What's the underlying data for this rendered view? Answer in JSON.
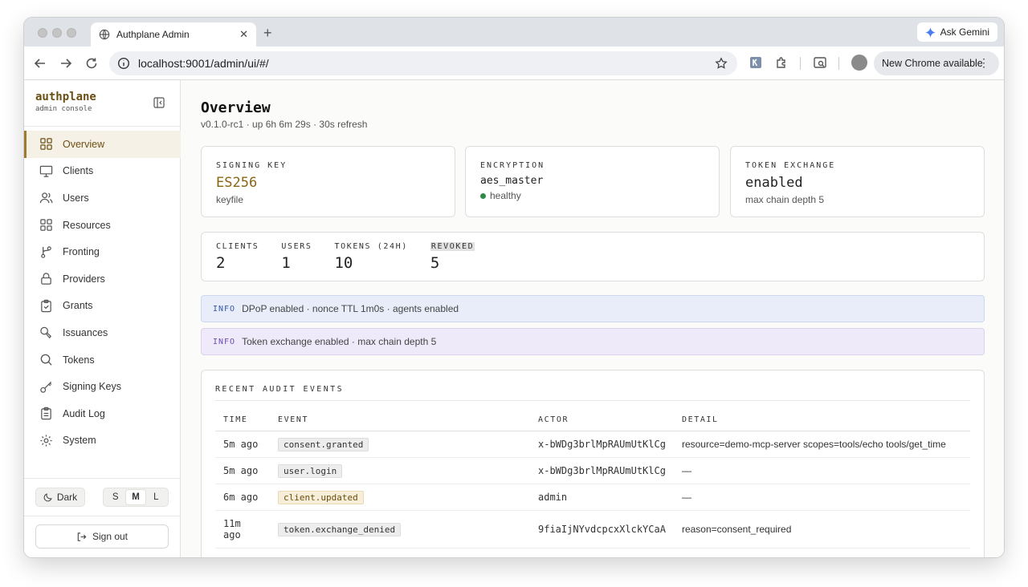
{
  "browser": {
    "tab_title": "Authplane Admin",
    "url": "localhost:9001/admin/ui/#/",
    "ask_gemini": "Ask Gemini",
    "update_label": "New Chrome available"
  },
  "brand": {
    "name": "authplane",
    "subtitle": "admin console"
  },
  "sidebar": {
    "items": [
      {
        "label": "Overview",
        "icon": "grid-icon"
      },
      {
        "label": "Clients",
        "icon": "monitor-icon"
      },
      {
        "label": "Users",
        "icon": "users-icon"
      },
      {
        "label": "Resources",
        "icon": "grid-icon"
      },
      {
        "label": "Fronting",
        "icon": "branch-icon"
      },
      {
        "label": "Providers",
        "icon": "lock-icon"
      },
      {
        "label": "Grants",
        "icon": "clipboard-check-icon"
      },
      {
        "label": "Issuances",
        "icon": "stamp-icon"
      },
      {
        "label": "Tokens",
        "icon": "search-icon"
      },
      {
        "label": "Signing Keys",
        "icon": "key-icon"
      },
      {
        "label": "Audit Log",
        "icon": "clipboard-list-icon"
      },
      {
        "label": "System",
        "icon": "gear-icon"
      }
    ],
    "theme_label": "Dark",
    "sizes": [
      "S",
      "M",
      "L"
    ],
    "selected_size": "M",
    "signout_label": "Sign out"
  },
  "overview": {
    "title": "Overview",
    "subtitle": "v0.1.0-rc1 · up 6h 6m 29s · 30s refresh",
    "cards": {
      "signing_key": {
        "label": "SIGNING KEY",
        "value": "ES256",
        "hint": "keyfile"
      },
      "encryption": {
        "label": "ENCRYPTION",
        "value": "aes_master",
        "hint": "healthy"
      },
      "token_exchange": {
        "label": "TOKEN EXCHANGE",
        "value": "enabled",
        "hint": "max chain depth 5"
      }
    },
    "stats": [
      {
        "label": "CLIENTS",
        "value": "2"
      },
      {
        "label": "USERS",
        "value": "1"
      },
      {
        "label": "TOKENS (24H)",
        "value": "10"
      },
      {
        "label": "REVOKED",
        "value": "5"
      }
    ],
    "banners": [
      {
        "tag": "INFO",
        "text": "DPoP enabled · nonce TTL 1m0s · agents enabled"
      },
      {
        "tag": "INFO",
        "text": "Token exchange enabled · max chain depth 5"
      }
    ],
    "audit": {
      "title": "RECENT AUDIT EVENTS",
      "headers": {
        "time": "TIME",
        "event": "EVENT",
        "actor": "ACTOR",
        "detail": "DETAIL"
      },
      "rows": [
        {
          "time": "5m ago",
          "event": "consent.granted",
          "actor": "x-bWDg3brlMpRAUmUtKlCg",
          "detail": "resource=demo-mcp-server scopes=tools/echo tools/get_time"
        },
        {
          "time": "5m ago",
          "event": "user.login",
          "actor": "x-bWDg3brlMpRAUmUtKlCg",
          "detail": "—"
        },
        {
          "time": "6m ago",
          "event": "client.updated",
          "actor": "admin",
          "detail": "—"
        },
        {
          "time": "11m ago",
          "event": "token.exchange_denied",
          "actor": "9fiaIjNYvdcpcxXlckYCaA",
          "detail": "reason=consent_required"
        }
      ]
    }
  },
  "colors": {
    "accent": "#8c6415",
    "active_nav_bg": "#f6f1e6",
    "healthy": "#2f8a48",
    "info_blue": "#3557a8",
    "info_purple": "#6d4bb0"
  }
}
